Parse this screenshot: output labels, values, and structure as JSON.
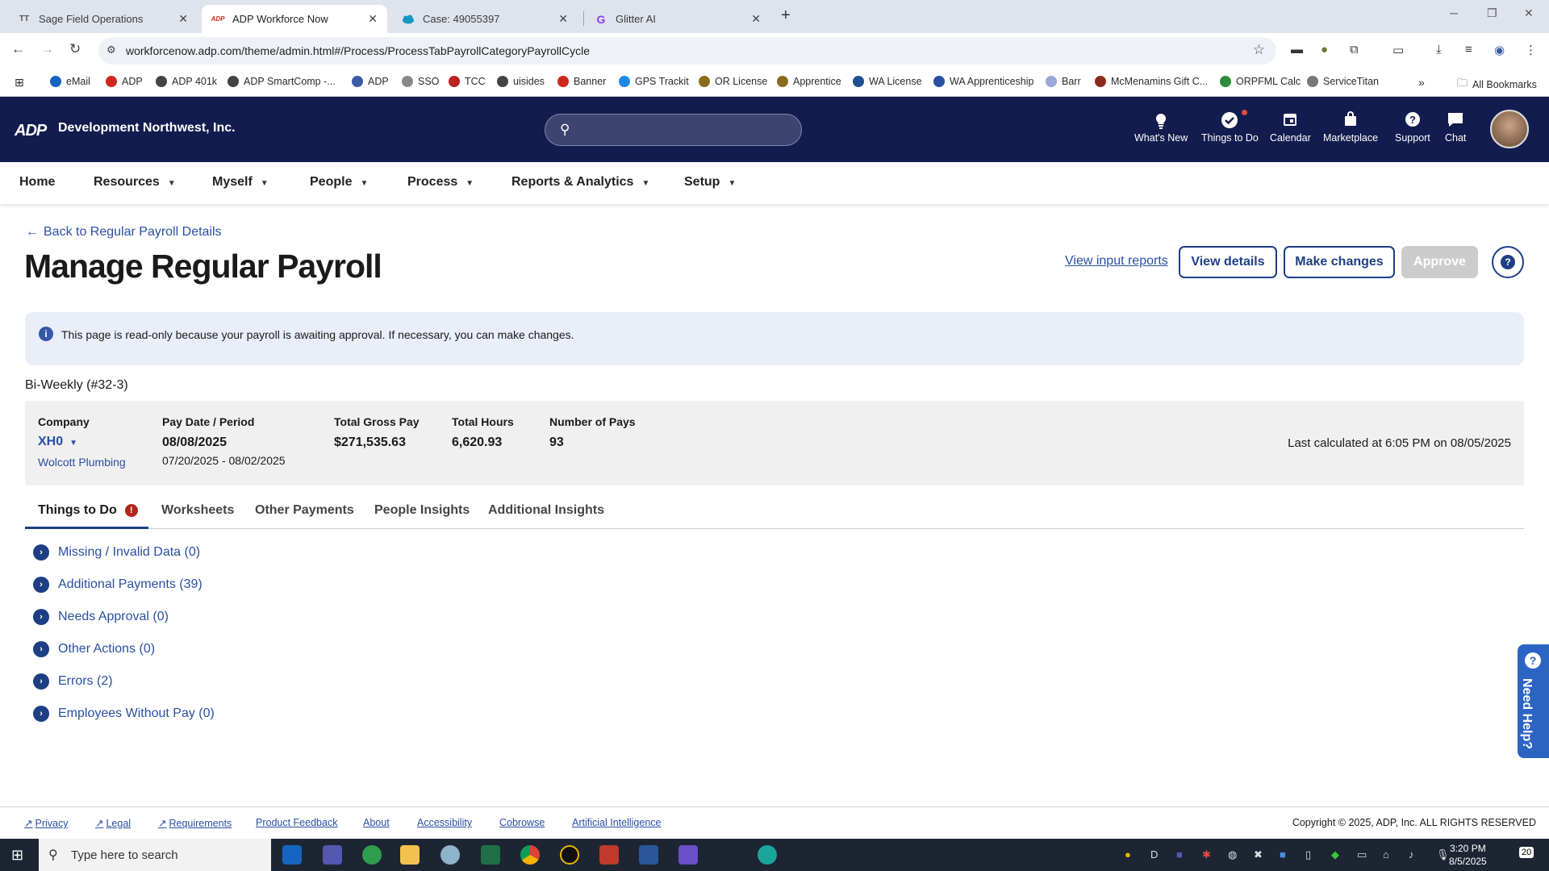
{
  "browser": {
    "tabs": [
      {
        "label": "Sage Field Operations",
        "icon": "TT"
      },
      {
        "label": "ADP Workforce Now",
        "icon": "ADP"
      },
      {
        "label": "Case: 49055397",
        "icon": "cloud"
      },
      {
        "label": "Glitter AI",
        "icon": "G"
      }
    ],
    "url": "workforcenow.adp.com/theme/admin.html#/Process/ProcessTabPayrollCategoryPayrollCycle",
    "bookmarks": [
      "eMail",
      "ADP",
      "ADP 401k",
      "ADP SmartComp -...",
      "ADP",
      "SSO",
      "TCC",
      "uisides",
      "Banner",
      "GPS Trackit",
      "OR License",
      "Apprentice",
      "WA License",
      "WA Apprenticeship",
      "Barr",
      "McMenamins Gift C...",
      "ORPFML Calc",
      "ServiceTitan"
    ],
    "all_bookmarks": "All Bookmarks"
  },
  "header": {
    "logo": "ADP",
    "company": "Development Northwest, Inc.",
    "items": [
      {
        "label": "What's New",
        "icon": "lightbulb-icon"
      },
      {
        "label": "Things to Do",
        "icon": "checkmark-icon"
      },
      {
        "label": "Calendar",
        "icon": "calendar-icon"
      },
      {
        "label": "Marketplace",
        "icon": "bag-icon"
      },
      {
        "label": "Support",
        "icon": "help-icon"
      },
      {
        "label": "Chat",
        "icon": "chat-icon"
      }
    ]
  },
  "nav": [
    "Home",
    "Resources",
    "Myself",
    "People",
    "Process",
    "Reports & Analytics",
    "Setup"
  ],
  "page": {
    "back": "Back to Regular Payroll Details",
    "title": "Manage Regular Payroll",
    "view_input_reports": "View input reports",
    "view_details": "View details",
    "make_changes": "Make changes",
    "approve": "Approve",
    "info": "This page is read-only because your payroll is awaiting approval. If necessary, you can make changes.",
    "cycle": "Bi-Weekly (#32-3)"
  },
  "summary": {
    "company_label": "Company",
    "company_code": "XH0",
    "company_name": "Wolcott Plumbing",
    "pay_date_label": "Pay Date / Period",
    "pay_date": "08/08/2025",
    "period": "07/20/2025 - 08/02/2025",
    "gross_label": "Total Gross Pay",
    "gross": "$271,535.63",
    "hours_label": "Total Hours",
    "hours": "6,620.93",
    "pays_label": "Number of Pays",
    "pays": "93",
    "last_calc": "Last calculated at 6:05 PM on 08/05/2025"
  },
  "tabs": [
    "Things to Do",
    "Worksheets",
    "Other Payments",
    "People Insights",
    "Additional Insights"
  ],
  "alert_glyph": "!",
  "items": [
    "Missing / Invalid Data (0)",
    "Additional Payments (39)",
    "Needs Approval (0)",
    "Other Actions (0)",
    "Errors (2)",
    "Employees Without Pay (0)"
  ],
  "need_help": "Need Help?",
  "footer": {
    "links": [
      "Privacy",
      "Legal",
      "Requirements",
      "Product Feedback",
      "About",
      "Accessibility",
      "Cobrowse",
      "Artificial Intelligence"
    ],
    "copyright": "Copyright © 2025, ADP, Inc. ALL RIGHTS RESERVED"
  },
  "taskbar": {
    "search": "Type here to search",
    "time": "3:20 PM",
    "date": "8/5/2025",
    "notifications": "20"
  }
}
